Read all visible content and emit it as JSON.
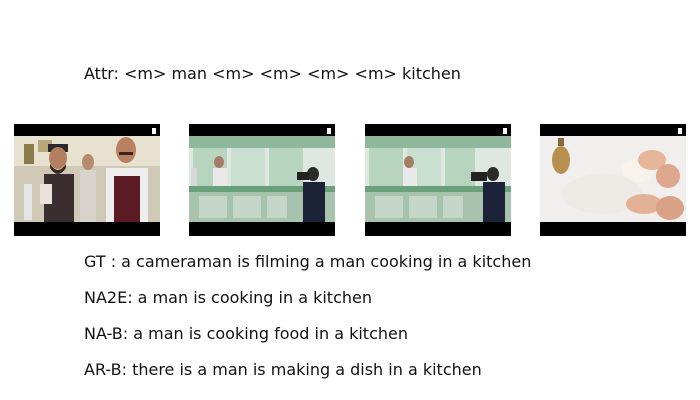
{
  "attr_text": "Attr: <m> man <m> <m> <m> <m> kitchen",
  "captions": [
    "GT  : a cameraman is filming a man cooking in a kitchen",
    "NA2E: a man is cooking in a kitchen",
    "NA-B: a man is cooking food in a kitchen",
    "AR-B: there is a man is making a dish in a kitchen"
  ],
  "colors": {
    "frame_border": "#000000",
    "text": "#111111"
  }
}
